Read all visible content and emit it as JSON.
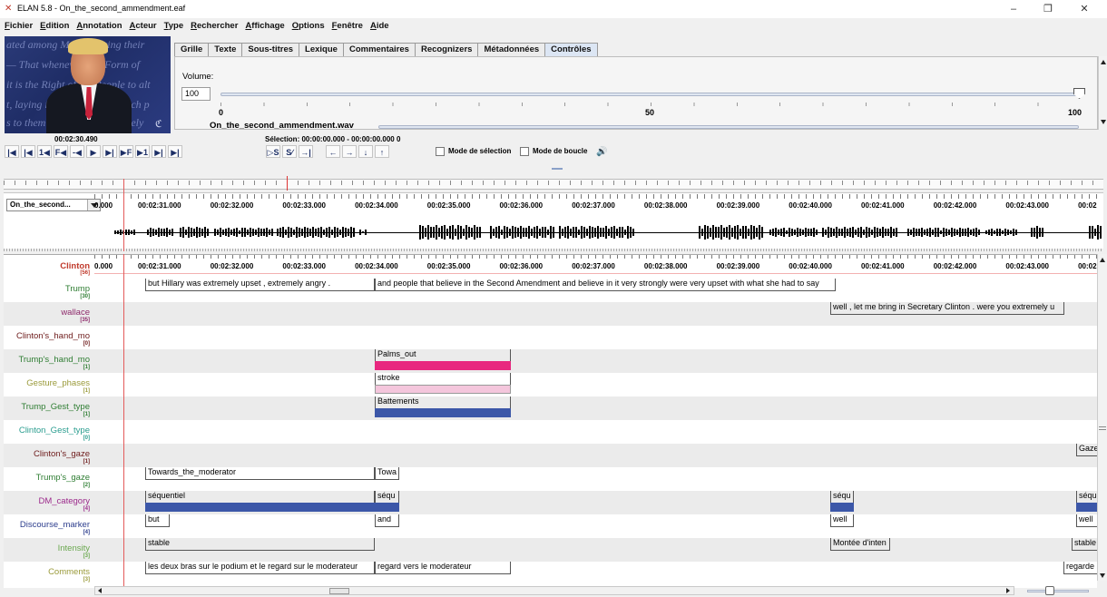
{
  "window": {
    "title": "ELAN 5.8 - On_the_second_ammendment.eaf",
    "minimize": "–",
    "maximize": "❐",
    "close": "✕"
  },
  "menu": [
    "Fichier",
    "Edition",
    "Annotation",
    "Acteur",
    "Type",
    "Rechercher",
    "Affichage",
    "Options",
    "Fenêtre",
    "Aide"
  ],
  "tabs": [
    "Grille",
    "Texte",
    "Sous-titres",
    "Lexique",
    "Commentaires",
    "Recognizers",
    "Métadonnées",
    "Contrôles"
  ],
  "active_tab": "Contrôles",
  "controls": {
    "volume_label": "Volume:",
    "volume_value": "100",
    "volume_level": 1.0,
    "ticks": [
      "0",
      "50",
      "100"
    ],
    "file_label": "On_the_second_ammendment.wav"
  },
  "player": {
    "current_time": "00:02:30.490",
    "selection": "Sélection: 00:00:00.000 - 00:00:00.000  0",
    "buttons": [
      "|◀",
      "|◀",
      "1◀",
      "F◀",
      "-◀",
      "▶",
      "▶|",
      "▶F",
      "▶1",
      "▶|",
      "▶|"
    ],
    "sel_buttons": [
      "▷S",
      "S∕",
      "→|"
    ],
    "nav_buttons": [
      "←",
      "→",
      "↓",
      "↑"
    ],
    "selection_mode": "Mode de sélection",
    "loop_mode": "Mode de boucle",
    "speaker_icon": "🔊"
  },
  "timeline": {
    "media_select": "On_the_second...",
    "start": "0.000",
    "times": [
      "00:02:31.000",
      "00:02:32.000",
      "00:02:33.000",
      "00:02:34.000",
      "00:02:35.000",
      "00:02:36.000",
      "00:02:37.000",
      "00:02:38.000",
      "00:02:39.000",
      "00:02:40.000",
      "00:02:41.000",
      "00:02:42.000",
      "00:02:43.000",
      "00:02"
    ]
  },
  "tiers": [
    {
      "name": "Clinton",
      "count": "[56]",
      "color": "#c0392b",
      "shaded": false
    },
    {
      "name": "Trump",
      "count": "[30]",
      "color": "#2e7d32",
      "shaded": false
    },
    {
      "name": "wallace",
      "count": "[35]",
      "color": "#8e2a6b",
      "shaded": true
    },
    {
      "name": "Clinton's_hand_mo",
      "count": "[0]",
      "color": "#6d1a1a",
      "shaded": false
    },
    {
      "name": "Trump's_hand_mo",
      "count": "[1]",
      "color": "#2e7d32",
      "shaded": true
    },
    {
      "name": "Gesture_phases",
      "count": "[1]",
      "color": "#9a9a3a",
      "shaded": false
    },
    {
      "name": "Trump_Gest_type",
      "count": "[1]",
      "color": "#2e7d32",
      "shaded": true
    },
    {
      "name": "Clinton_Gest_type",
      "count": "[0]",
      "color": "#2a9d8f",
      "shaded": false
    },
    {
      "name": "Clinton's_gaze",
      "count": "[1]",
      "color": "#6d1a1a",
      "shaded": true
    },
    {
      "name": "Trump's_gaze",
      "count": "[2]",
      "color": "#2e7d32",
      "shaded": false
    },
    {
      "name": "DM_category",
      "count": "[4]",
      "color": "#9c2a8c",
      "shaded": true
    },
    {
      "name": "Discourse_marker",
      "count": "[4]",
      "color": "#2b3c8c",
      "shaded": false
    },
    {
      "name": "Intensity",
      "count": "[3]",
      "color": "#6aa84f",
      "shaded": true
    },
    {
      "name": "Comments",
      "count": "[3]",
      "color": "#9a9a3a",
      "shaded": false
    }
  ],
  "annotations": {
    "trump_1": "but Hillary was extremely upset , extremely angry .",
    "trump_2": "and people that believe in the Second Amendment and believe in it very strongly were very upset with what she had to say",
    "wallace_1": "well , let me bring in Secretary Clinton . were you extremely u",
    "trump_hand_1": "Palms_out",
    "gesture_1": "stroke",
    "gest_type_1": "Battements",
    "clinton_gaze_1": "Gaze",
    "trump_gaze_1": "Towards_the_moderator",
    "trump_gaze_2": "Towa",
    "dm_1": "séquentiel",
    "dm_2": "séqu",
    "dm_3": "séqu",
    "dm_4": "séqu",
    "dmk_1": "but",
    "dmk_2": "and",
    "dmk_3": "well",
    "dmk_4": "well",
    "int_1": "stable",
    "int_2": "Montée d'inten",
    "int_3": "stable",
    "com_1": "les deux bras sur le podium et le regard sur le moderateur",
    "com_2": "regard vers le moderateur",
    "com_3": "regarde"
  },
  "video": {
    "slogan_lines": [
      "ated among Men, deriving their",
      "— That whenever any Form of",
      "it is the Right of the People to alt",
      "t, laying its foundation on such p",
      "s to them shall seem most likely"
    ],
    "logo": "ℭ"
  },
  "colors": {
    "pink_bar": "#e8287f",
    "light_pink_bar": "#f4c6dc",
    "blue_bar": "#3c57a8",
    "cursor": "#e35a5a",
    "active_tab": "#dce6f4"
  }
}
